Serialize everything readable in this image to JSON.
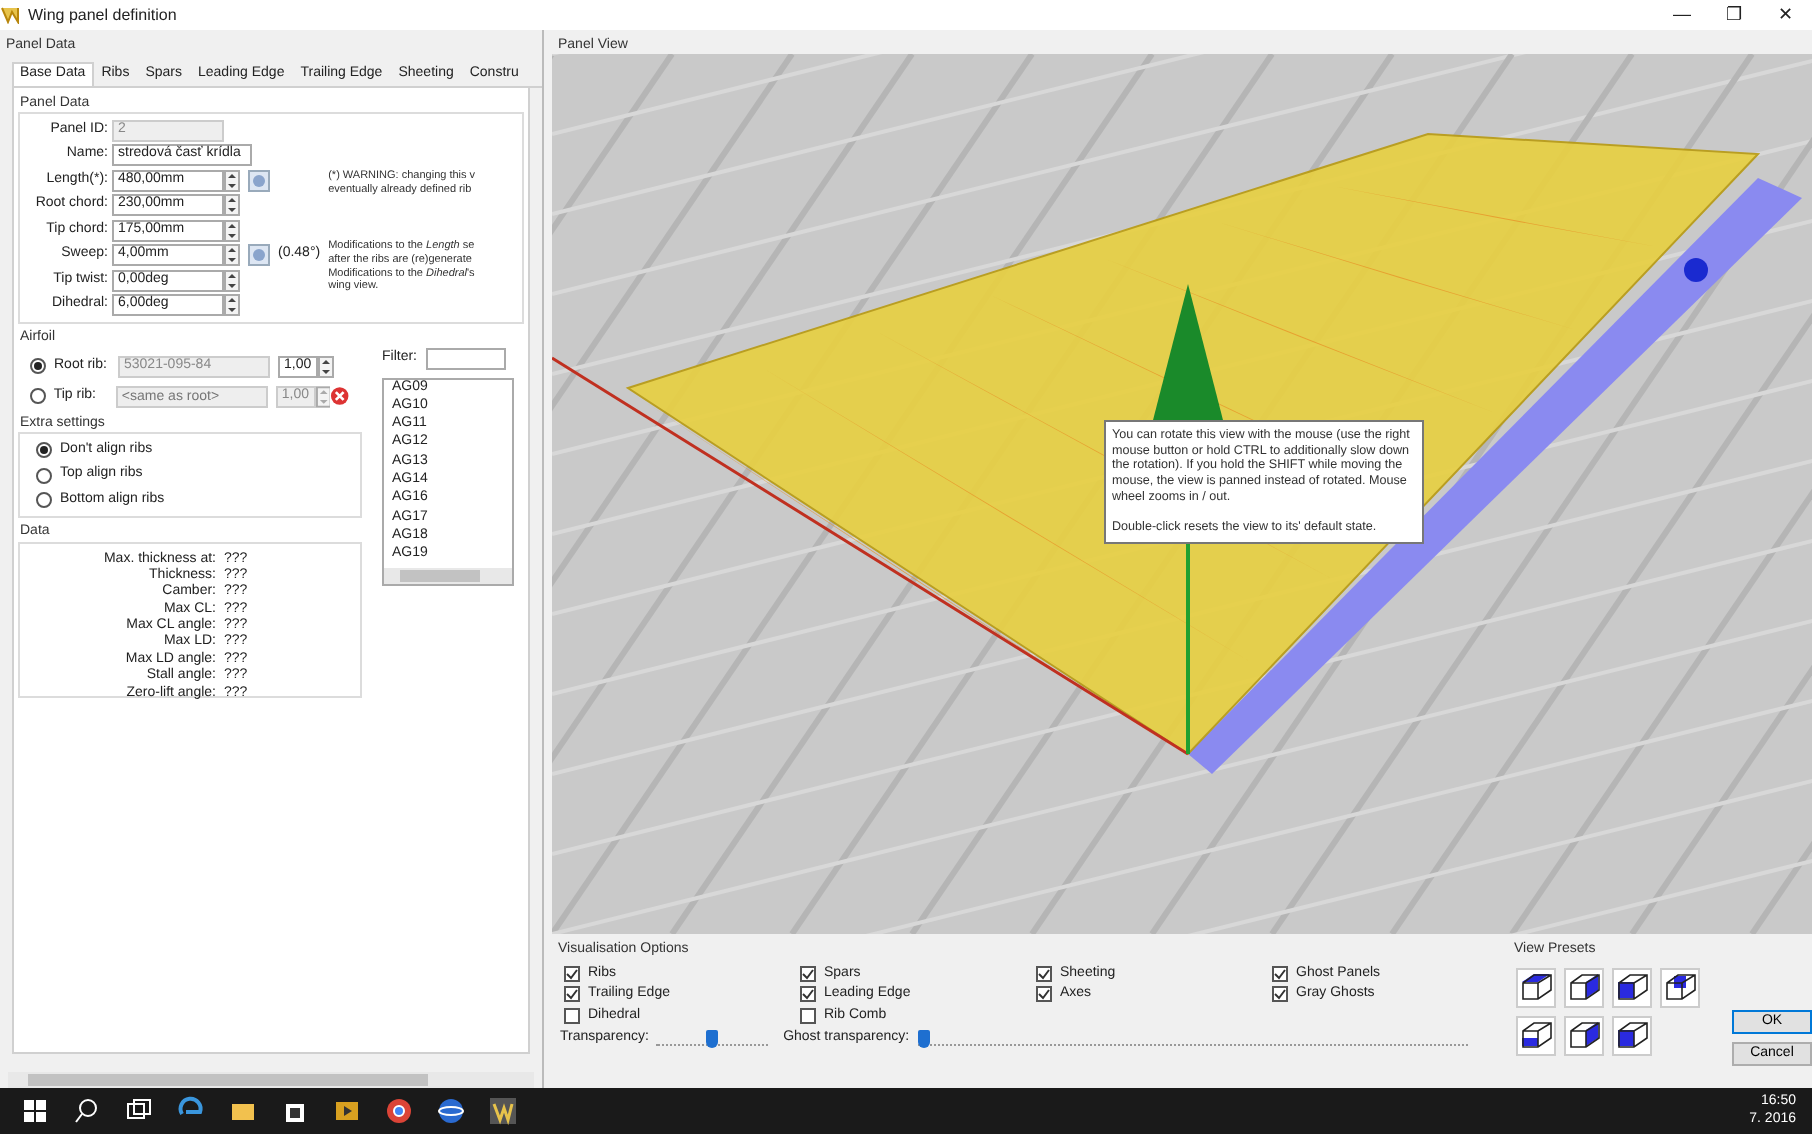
{
  "window": {
    "title": "Wing panel definition",
    "controls": [
      "—",
      "❐",
      "✕"
    ]
  },
  "panel_data": {
    "title": "Panel Data",
    "tabs": [
      {
        "label": "Base Data",
        "selected": true
      },
      {
        "label": "Ribs",
        "selected": false
      },
      {
        "label": "Spars",
        "selected": false
      },
      {
        "label": "Leading Edge",
        "selected": false
      },
      {
        "label": "Trailing Edge",
        "selected": false
      },
      {
        "label": "Sheeting",
        "selected": false
      },
      {
        "label": "Constru",
        "selected": false
      }
    ],
    "base": {
      "title": "Panel Data",
      "fields": [
        {
          "label": "Panel ID:",
          "value": "2",
          "kind": "readonly",
          "button": false
        },
        {
          "label": "Name:",
          "value": "stredová časť krídla",
          "kind": "text",
          "button": false
        },
        {
          "label": "Length(*):",
          "value": "480,00mm",
          "kind": "spin",
          "button": true
        },
        {
          "label": "Root chord:",
          "value": "230,00mm",
          "kind": "spin",
          "button": false
        },
        {
          "label": "Tip chord:",
          "value": "175,00mm",
          "kind": "spin",
          "button": false
        },
        {
          "label": "Sweep:",
          "value": "4,00mm",
          "kind": "spin",
          "button": true,
          "extra": "(0.48°)"
        },
        {
          "label": "Tip twist:",
          "value": "0,00deg",
          "kind": "spin",
          "button": false
        },
        {
          "label": "Dihedral:",
          "value": "6,00deg",
          "kind": "spin",
          "button": false
        }
      ],
      "notes": [
        [
          "(*) WARNING: changing this v",
          "eventually already defined rib"
        ],
        [
          "Modifications to the *Length* se",
          "after the ribs are (re)generate",
          "Modifications to the *Dihedral*'s",
          "wing view."
        ]
      ]
    },
    "airfoil": {
      "title": "Airfoil",
      "ribs": [
        {
          "label": "Root rib:",
          "value": "53021-095-84",
          "scale": "1,00",
          "selected": true,
          "delete_button": false
        },
        {
          "label": "Tip rib:",
          "placeholder": "<same as root>",
          "scale": "1,00",
          "selected": false,
          "delete_button": true
        }
      ],
      "filter_label": "Filter:",
      "airfoils": [
        "AG09",
        "AG10",
        "AG11",
        "AG12",
        "AG13",
        "AG14",
        "AG16",
        "AG17",
        "AG18",
        "AG19"
      ]
    },
    "extra_settings": {
      "title": "Extra settings",
      "options": [
        {
          "label": "Don't align ribs",
          "selected": true
        },
        {
          "label": "Top align ribs",
          "selected": false
        },
        {
          "label": "Bottom align ribs",
          "selected": false
        }
      ]
    },
    "data": {
      "title": "Data",
      "rows": [
        {
          "label": "Max. thickness at:",
          "value": "???"
        },
        {
          "label": "Thickness:",
          "value": "???"
        },
        {
          "label": "Camber:",
          "value": "???"
        },
        {
          "label": "Max CL:",
          "value": "???"
        },
        {
          "label": "Max CL angle:",
          "value": "???"
        },
        {
          "label": "Max LD:",
          "value": "???"
        },
        {
          "label": "Max LD angle:",
          "value": "???"
        },
        {
          "label": "Stall angle:",
          "value": "???"
        },
        {
          "label": "Zero-lift angle:",
          "value": "???"
        }
      ]
    }
  },
  "panel_view": {
    "title": "Panel View",
    "tooltip": [
      "You can rotate this view with the mouse (use the right mouse button or hold CTRL to additionally slow down the rotation). If you hold the SHIFT while moving the mouse, the view is panned instead of rotated. Mouse wheel zooms in / out.",
      "Double-click resets the view to its' default state."
    ]
  },
  "visualisation": {
    "title": "Visualisation Options",
    "options": [
      {
        "label": "Ribs",
        "checked": true
      },
      {
        "label": "Spars",
        "checked": true
      },
      {
        "label": "Sheeting",
        "checked": true
      },
      {
        "label": "Ghost Panels",
        "checked": true
      },
      {
        "label": "Trailing Edge",
        "checked": true
      },
      {
        "label": "Leading Edge",
        "checked": true
      },
      {
        "label": "Axes",
        "checked": true
      },
      {
        "label": "Gray Ghosts",
        "checked": true
      },
      {
        "label": "Dihedral",
        "checked": false
      },
      {
        "label": "Rib Comb",
        "checked": false
      }
    ],
    "sliders": [
      {
        "label": "Transparency:",
        "level": 0.5
      },
      {
        "label": "Ghost transparency:",
        "level": 0.0
      }
    ]
  },
  "view_presets": {
    "title": "View Presets"
  },
  "buttons": [
    {
      "label": "OK",
      "default": true
    },
    {
      "label": "Cancel",
      "default": false
    }
  ],
  "taskbar": {
    "time": "16:50",
    "date": "7. 2016"
  }
}
